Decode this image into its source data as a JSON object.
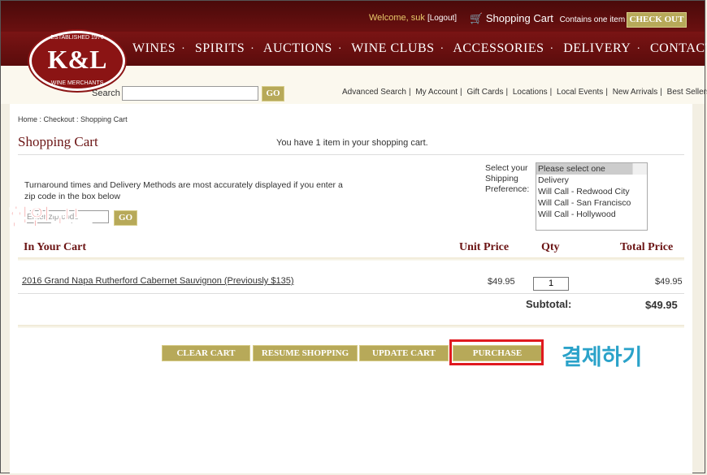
{
  "header": {
    "welcome": "Welcome, suk",
    "logout": "[Logout]",
    "cart_label": "Shopping Cart",
    "cart_note": "Contains one item",
    "checkout": "CHECK OUT"
  },
  "logo": {
    "monogram": "K&L",
    "ring_top": "ESTABLISHED 1976",
    "ring_bottom": "WINE MERCHANTS"
  },
  "nav": [
    "WINES",
    "SPIRITS",
    "AUCTIONS",
    "WINE CLUBS",
    "ACCESSORIES",
    "DELIVERY",
    "CONTACT"
  ],
  "search": {
    "label": "Search",
    "go": "GO",
    "value": ""
  },
  "links": [
    "Advanced Search",
    "My Account",
    "Gift Cards",
    "Locations",
    "Local Events",
    "New Arrivals",
    "Best Sellers"
  ],
  "breadcrumb": "Home :  Checkout : Shopping Cart",
  "page_title": "Shopping Cart",
  "cart_count": "You have 1 item in your shopping cart.",
  "turnaround": "Turnaround times and Delivery Methods are most accurately displayed if you enter a zip code in the box below",
  "zip": {
    "placeholder": "Enter zip code",
    "go": "GO"
  },
  "annotations": {
    "discount": "할인코드",
    "pay": "결제하기"
  },
  "shipping": {
    "label": "Select your Shipping Preference:",
    "options": [
      "Please select one",
      "Delivery",
      "Will Call - Redwood City",
      "Will Call - San Francisco",
      "Will Call - Hollywood"
    ]
  },
  "table": {
    "headers": {
      "item": "In Your Cart",
      "unit_price": "Unit Price",
      "qty": "Qty",
      "total": "Total Price"
    },
    "items": [
      {
        "name": "2016 Grand Napa Rutherford Cabernet Sauvignon (Previously $135)",
        "unit_price": "$49.95",
        "qty": "1",
        "total": "$49.95"
      }
    ],
    "subtotal_label": "Subtotal:",
    "subtotal_value": "$49.95"
  },
  "buttons": {
    "clear": "CLEAR CART",
    "resume": "RESUME SHOPPING",
    "update": "UPDATE CART",
    "purchase": "PURCHASE"
  }
}
